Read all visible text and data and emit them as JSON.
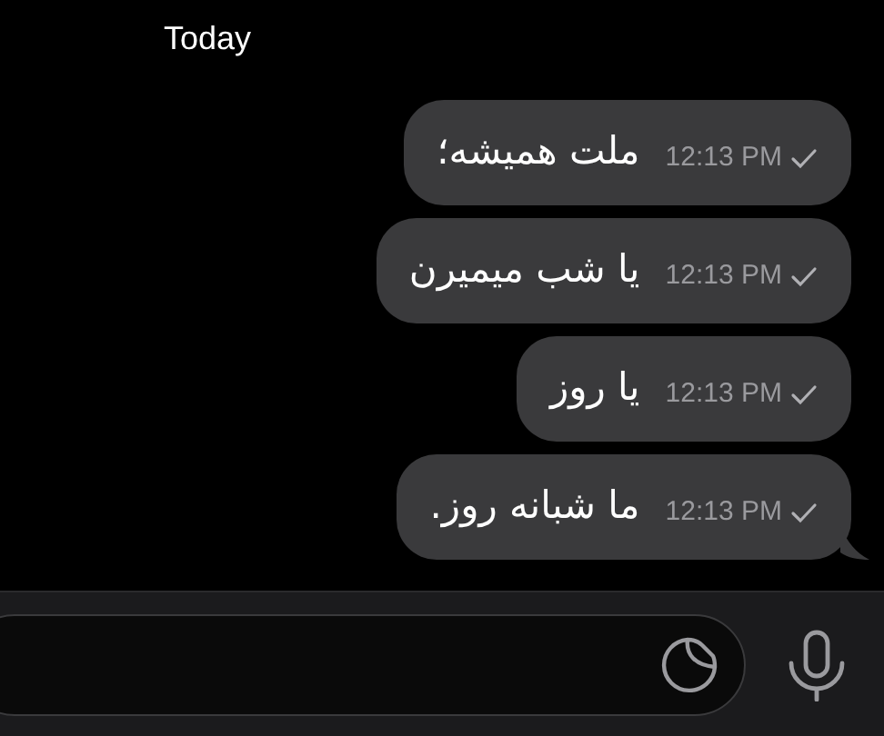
{
  "date_header": "Today",
  "messages": [
    {
      "text": "ملت همیشه؛",
      "time": "12:13 PM",
      "tail": false
    },
    {
      "text": "یا شب میمیرن",
      "time": "12:13 PM",
      "tail": false
    },
    {
      "text": "یا روز",
      "time": "12:13 PM",
      "tail": false
    },
    {
      "text": "ما شبانه روز.",
      "time": "12:13 PM",
      "tail": true
    }
  ]
}
